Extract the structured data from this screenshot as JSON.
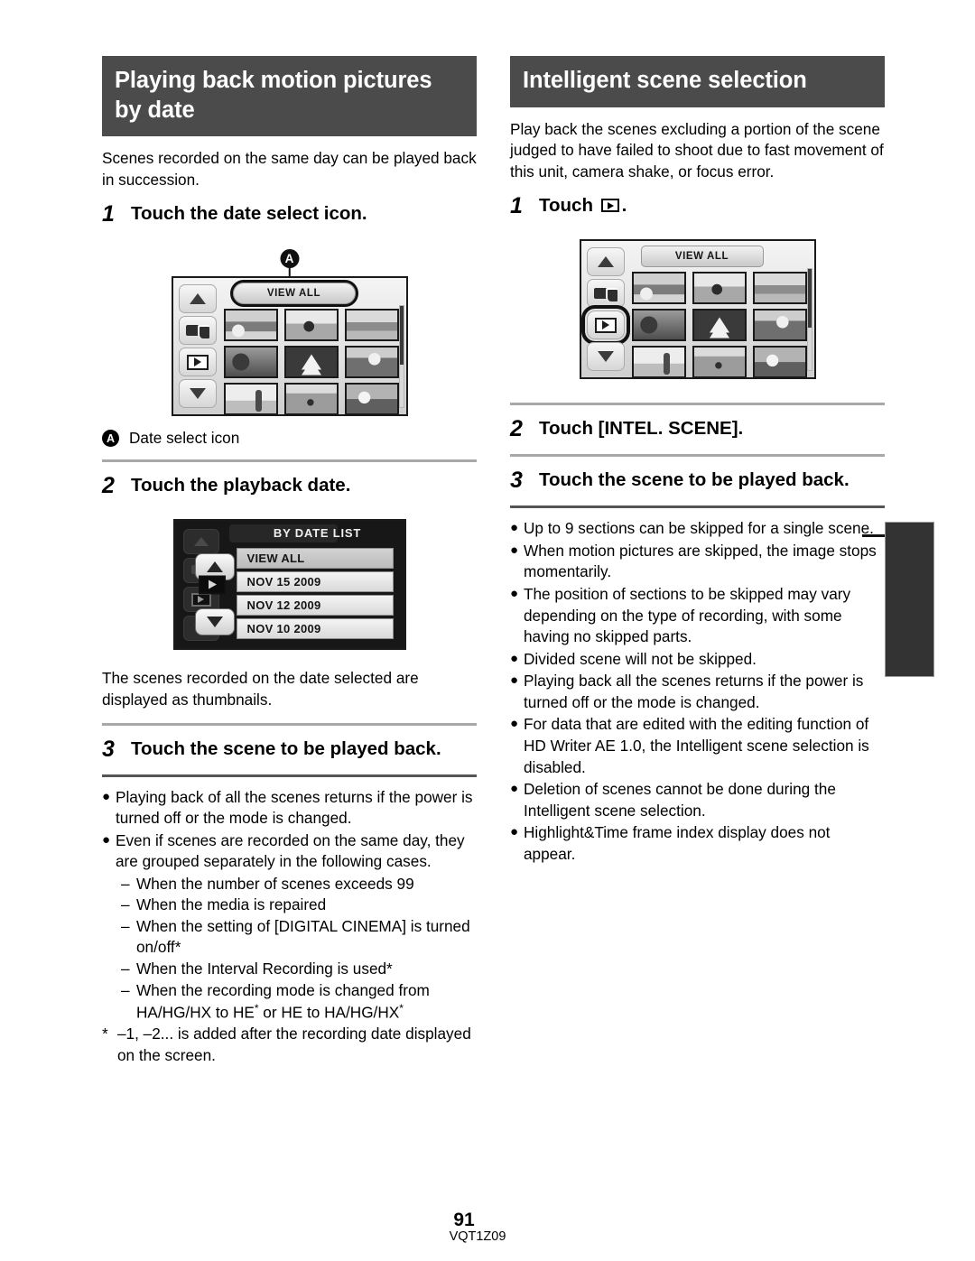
{
  "left_column": {
    "section_title": "Playing back motion pictures by date",
    "intro": "Scenes recorded on the same day can be played back in succession.",
    "step1": {
      "number": "1",
      "text": "Touch the date select icon."
    },
    "figure1": {
      "view_all_label": "VIEW ALL",
      "callout_badge": "A"
    },
    "callout": {
      "badge": "A",
      "label": "Date select icon"
    },
    "step2": {
      "number": "2",
      "text": "Touch the playback date."
    },
    "figure2": {
      "title": "BY DATE LIST",
      "ghost_label": "VIEW ALL",
      "items": [
        "VIEW ALL",
        "NOV 15 2009",
        "NOV 12 2009",
        "NOV 10 2009"
      ]
    },
    "after_fig2": "The scenes recorded on the date selected are displayed as thumbnails.",
    "step3": {
      "number": "3",
      "text": "Touch the scene to be played back."
    },
    "bullets": [
      "Playing back of all the scenes returns if the power is turned off or the mode is changed.",
      "Even if scenes are recorded on the same day, they are grouped separately in the following cases."
    ],
    "subitems": [
      "When the number of scenes exceeds 99",
      "When the media is repaired",
      "When the setting of [DIGITAL CINEMA] is turned on/off*",
      "When the Interval Recording is used*"
    ],
    "subitem_last_a": "When the recording mode is changed from",
    "subitem_last_b1": "HA/HG/HX to HE",
    "subitem_last_b2": " or HE to HA/HG/HX",
    "footnote_marker": "*",
    "footnote": "–1, –2... is added after the recording date displayed on the screen."
  },
  "right_column": {
    "section_title": "Intelligent scene selection",
    "intro": "Play back the scenes excluding a portion of the scene judged to have failed to shoot due to fast movement of this unit, camera shake, or focus error.",
    "step1": {
      "number": "1",
      "text_before": "Touch",
      "icon": "play-icon",
      "text_after": "."
    },
    "figure1": {
      "view_all_label": "VIEW ALL",
      "highlighted_icon": "play-icon"
    },
    "step2": {
      "number": "2",
      "text": "Touch [INTEL. SCENE]."
    },
    "step3": {
      "number": "3",
      "text": "Touch the scene to be played back."
    },
    "bullets": [
      "Up to 9 sections can be skipped for a single scene.",
      "When motion pictures are skipped, the image stops momentarily.",
      "The position of sections to be skipped may vary depending on the type of recording, with some having no skipped parts.",
      "Divided scene will not be skipped.",
      "Playing back all the scenes returns if the power is turned off or the mode is changed.",
      "For data that are edited with the editing function of HD Writer AE 1.0, the Intelligent scene selection is disabled.",
      "Deletion of scenes cannot be done during the Intelligent scene selection.",
      "Highlight&Time frame index display does not appear."
    ]
  },
  "footer": {
    "page_number": "91",
    "document_code": "VQT1Z09"
  },
  "colors": {
    "header_bar": "#4b4b4b",
    "rule": "#a8a8a8",
    "index_tab": "#333333"
  }
}
